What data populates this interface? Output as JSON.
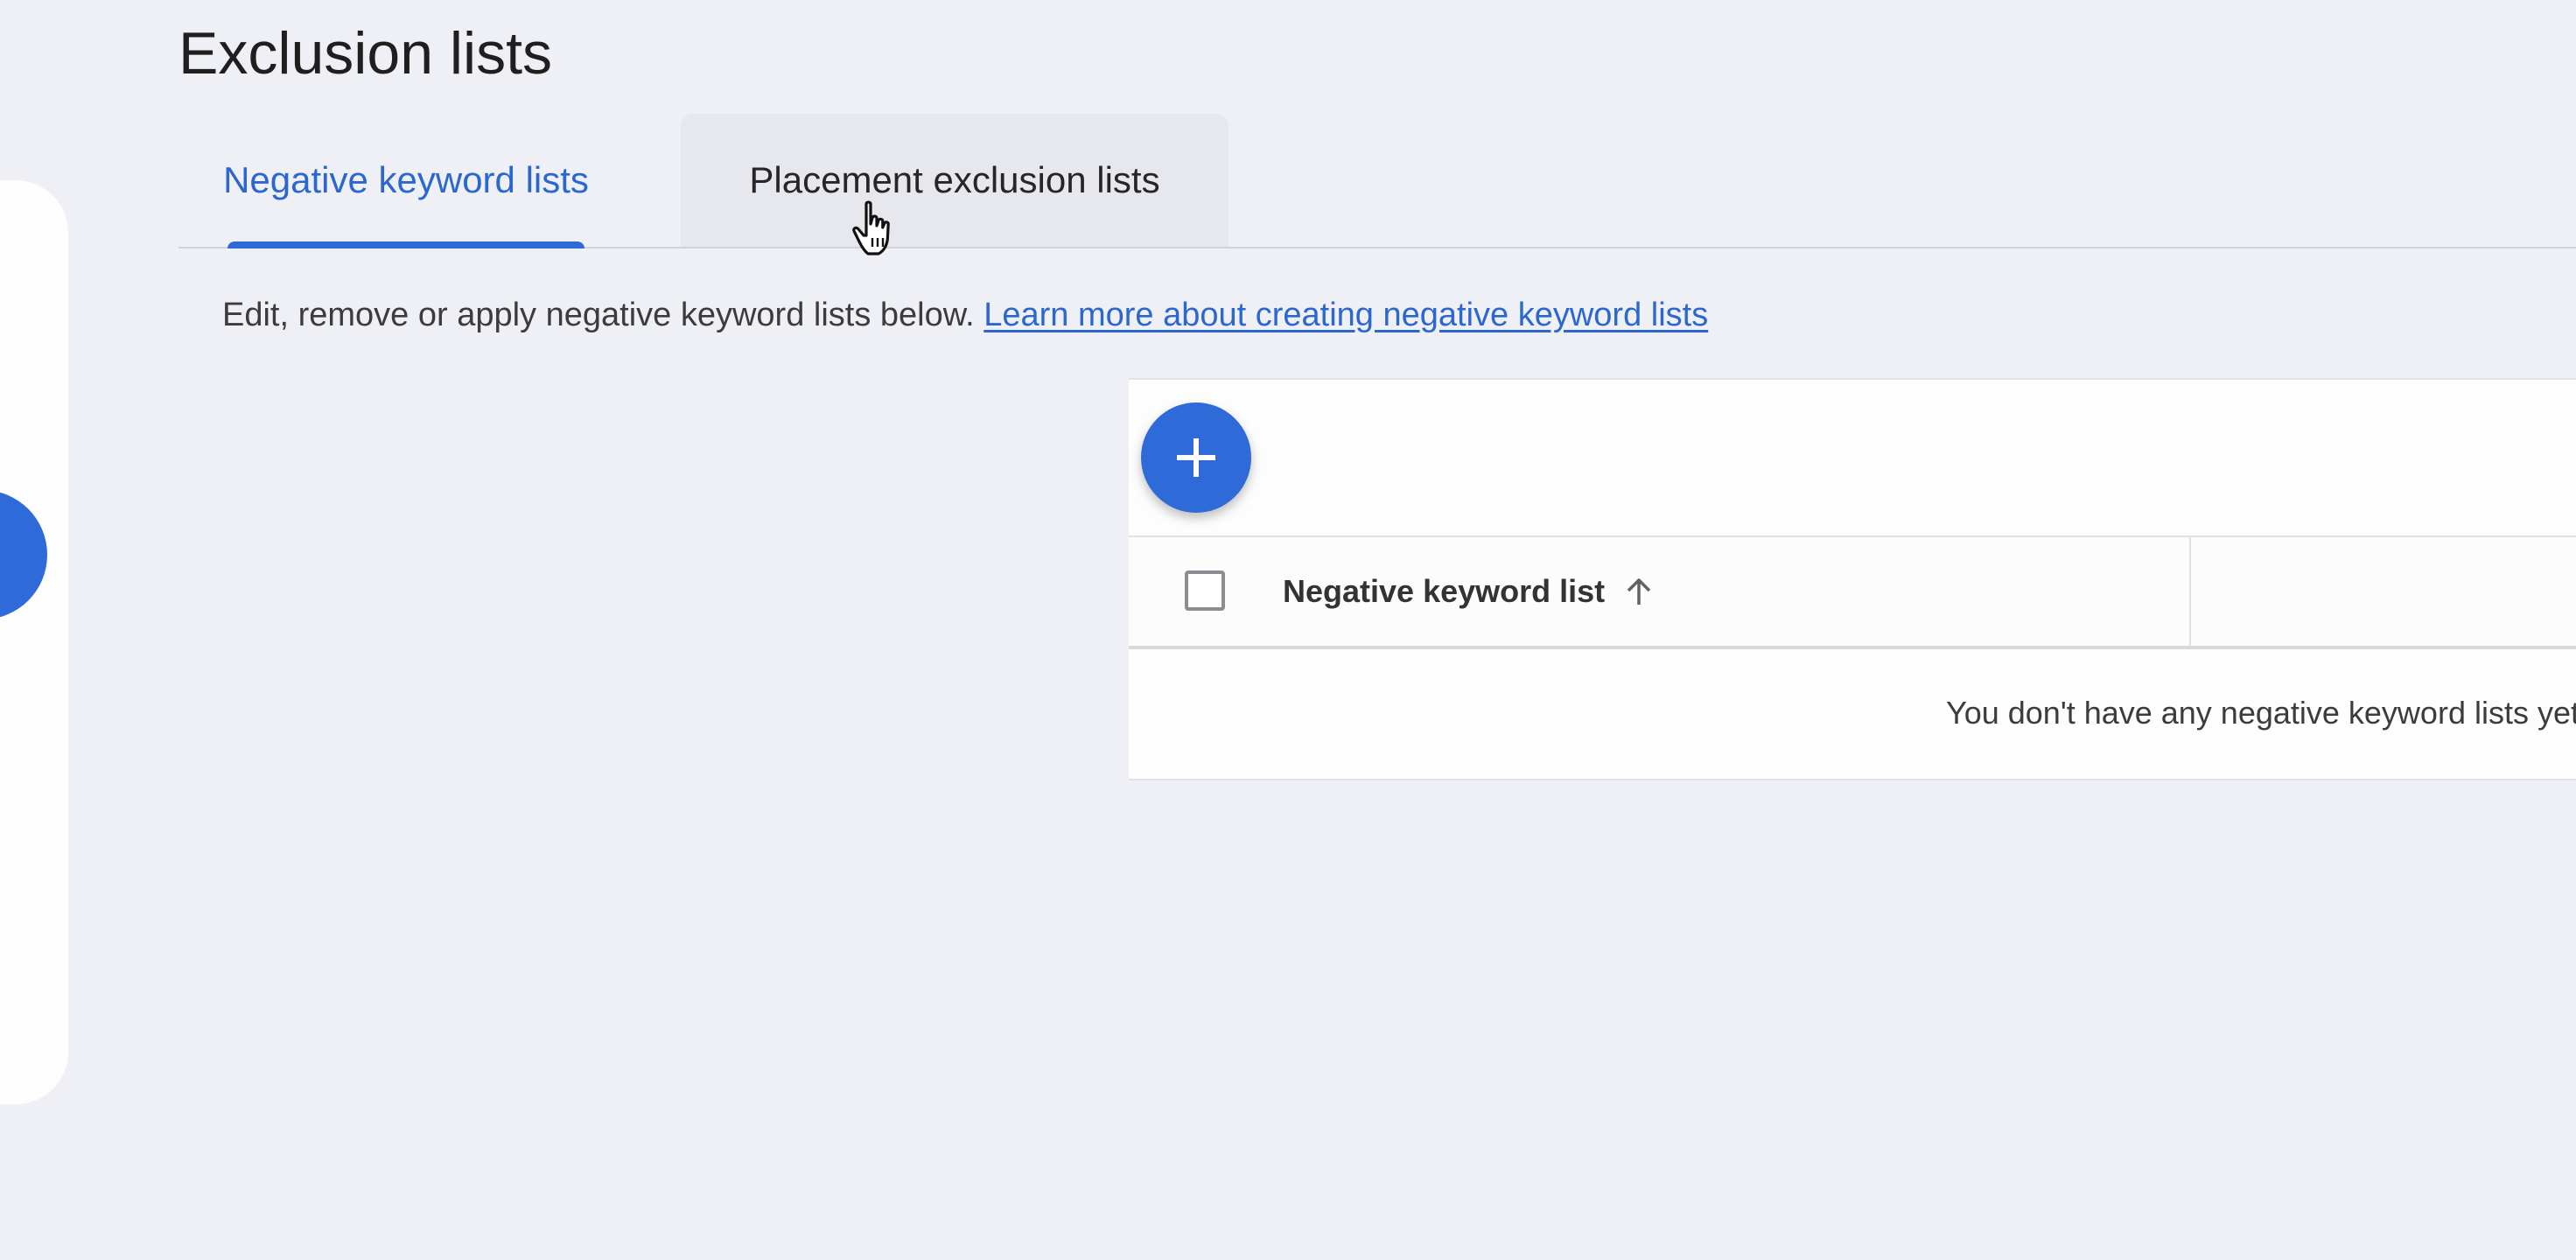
{
  "page": {
    "title": "Exclusion lists"
  },
  "tabs": [
    {
      "label": "Negative keyword lists",
      "active": true
    },
    {
      "label": "Placement exclusion lists",
      "active": false,
      "hovered": true
    }
  ],
  "intro": {
    "text": "Edit, remove or apply negative keyword lists below. ",
    "link_text": "Learn more about creating negative keyword lists"
  },
  "table": {
    "add_button_icon": "plus-icon",
    "columns": [
      {
        "label": "Negative keyword list",
        "sort": "ascending",
        "sort_icon": "arrow-up-icon"
      }
    ],
    "empty_message": "You don't have any negative keyword lists yet"
  },
  "colors": {
    "accent": "#2f6bd8",
    "link": "#2c67cf",
    "background": "#eef0f5",
    "card": "#fdfdfe"
  }
}
